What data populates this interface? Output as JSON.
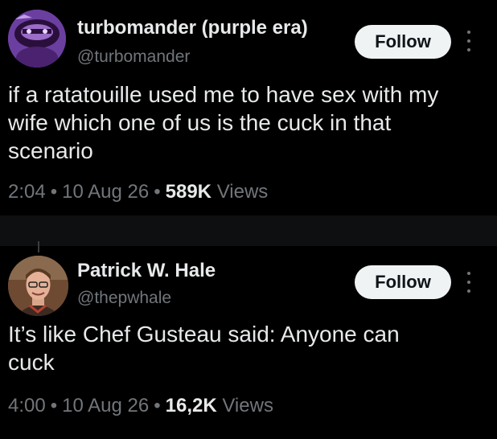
{
  "tweets": [
    {
      "display_name": "turbomander (purple era)",
      "handle": "@turbomander",
      "follow_label": "Follow",
      "text": "if a ratatouille used me to have sex with my\nwife which one of us is the cuck in that\nscenario",
      "time": "2:04",
      "date": "10 Aug 26",
      "views_count": "589K",
      "views_label": "Views",
      "separator": "•",
      "avatar_icon": "purple-creature-avatar"
    },
    {
      "display_name": "Patrick W. Hale",
      "handle": "@thepwhale",
      "follow_label": "Follow",
      "text": "It’s like Chef Gusteau said: Anyone can\ncuck",
      "time": "4:00",
      "date": "10 Aug 26",
      "views_count": "16,2K",
      "views_label": "Views",
      "separator": "•",
      "avatar_icon": "man-portrait-avatar"
    }
  ],
  "colors": {
    "background": "#000000",
    "text_primary": "#e7e9ea",
    "text_secondary": "#71767b",
    "follow_bg": "#eff3f4",
    "separator_band": "#0e0f10"
  }
}
